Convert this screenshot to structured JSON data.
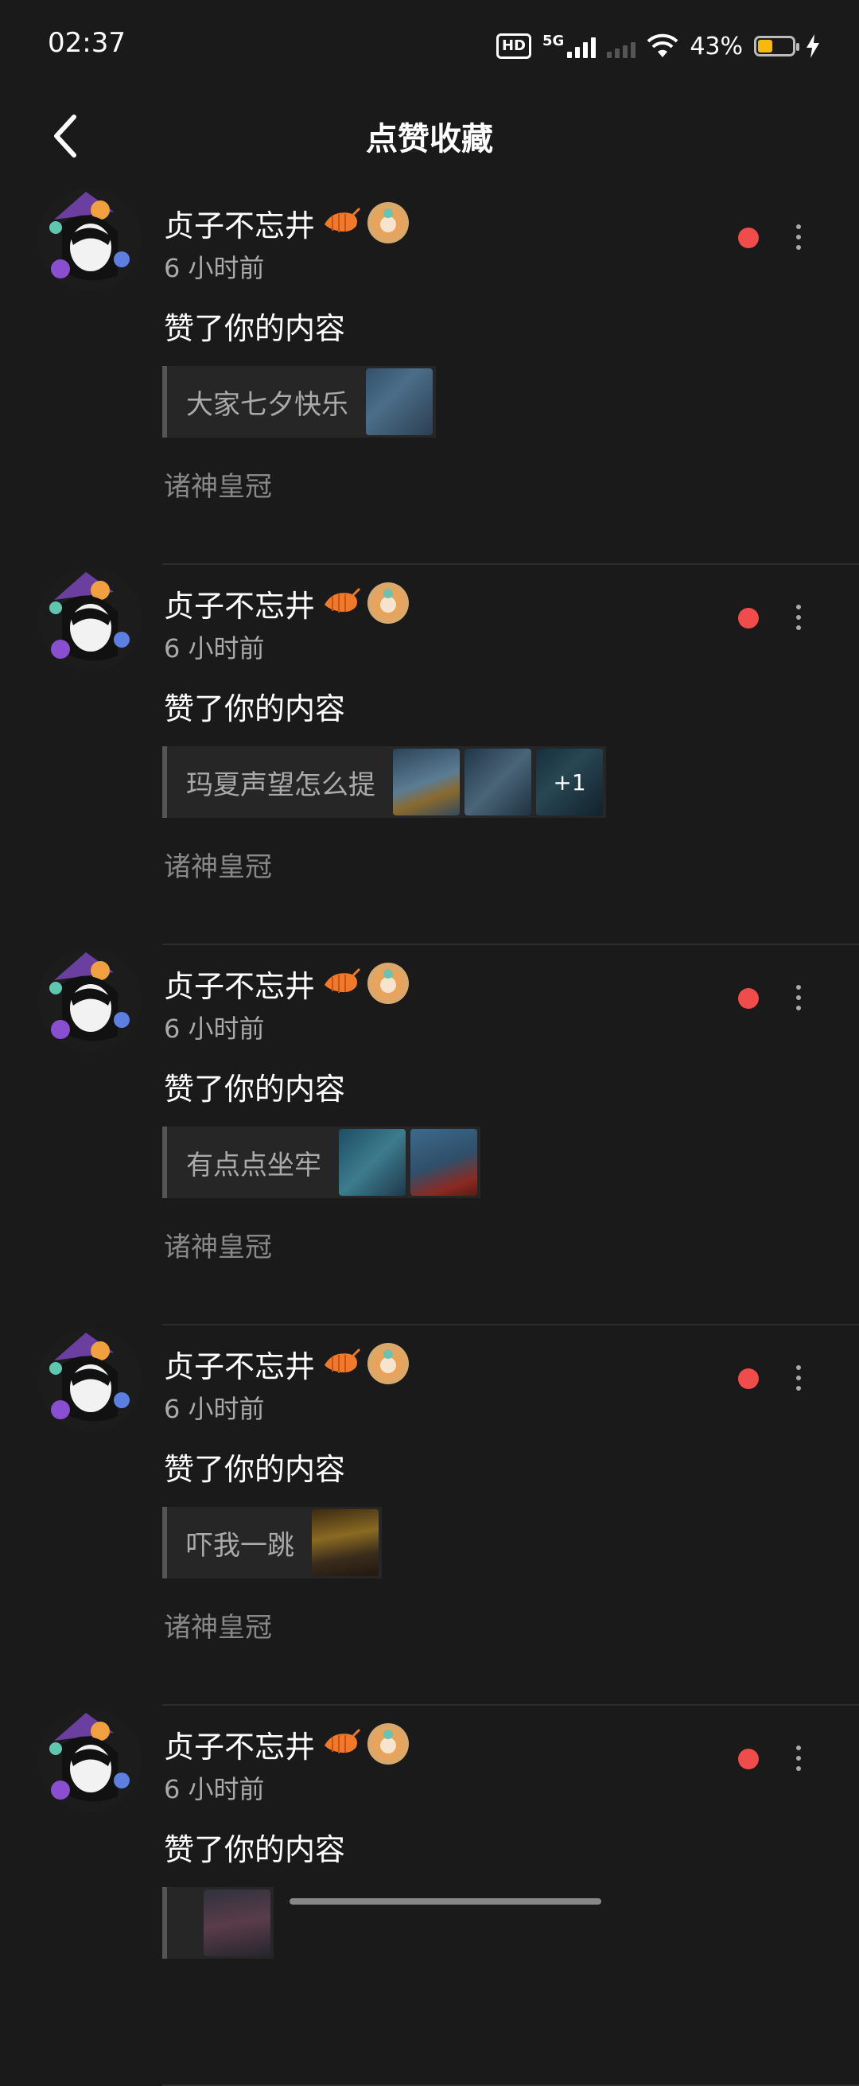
{
  "status_bar": {
    "time": "02:37",
    "hd": "HD",
    "network": "5G",
    "battery_percent": "43%"
  },
  "header": {
    "title": "点赞收藏"
  },
  "items": [
    {
      "user": "贞子不忘井",
      "time_ago": "6 小时前",
      "action": "赞了你的内容",
      "post_title": "大家七夕快乐",
      "thumbs": [
        "t1"
      ],
      "more_count": "",
      "source": "诸神皇冠"
    },
    {
      "user": "贞子不忘井",
      "time_ago": "6 小时前",
      "action": "赞了你的内容",
      "post_title": "玛夏声望怎么提",
      "thumbs": [
        "t2",
        "t3",
        "t4"
      ],
      "more_count": "+1",
      "source": "诸神皇冠"
    },
    {
      "user": "贞子不忘井",
      "time_ago": "6 小时前",
      "action": "赞了你的内容",
      "post_title": "有点点坐牢",
      "thumbs": [
        "t5",
        "t6"
      ],
      "more_count": "",
      "source": "诸神皇冠"
    },
    {
      "user": "贞子不忘井",
      "time_ago": "6 小时前",
      "action": "赞了你的内容",
      "post_title": "吓我一跳",
      "thumbs": [
        "t7"
      ],
      "more_count": "",
      "source": "诸神皇冠"
    },
    {
      "user": "贞子不忘井",
      "time_ago": "6 小时前",
      "action": "赞了你的内容",
      "post_title": "",
      "thumbs": [
        "t8"
      ],
      "more_count": "",
      "source": ""
    }
  ],
  "colors": {
    "unread_dot": "#f04c4c",
    "background": "#1a1a1a",
    "battery": "#f6b90d"
  }
}
